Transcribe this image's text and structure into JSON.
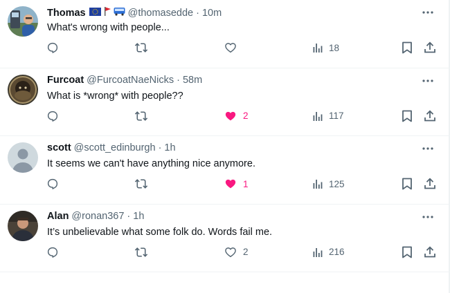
{
  "tweets": [
    {
      "name": "Thomas",
      "emojis": [
        "eu-flag",
        "red-flag",
        "bus"
      ],
      "handle": "@thomasedde",
      "separator": "·",
      "time": "10m",
      "text": "What's wrong with people...",
      "likes": "",
      "liked": false,
      "views": "18"
    },
    {
      "name": "Furcoat",
      "emojis": [],
      "handle": "@FurcoatNaeNicks",
      "separator": "·",
      "time": "58m",
      "text": "What is *wrong* with people??",
      "likes": "2",
      "liked": true,
      "views": "117"
    },
    {
      "name": "scott",
      "emojis": [],
      "handle": "@scott_edinburgh",
      "separator": "·",
      "time": "1h",
      "text": "It seems we can't have anything nice anymore.",
      "likes": "1",
      "liked": true,
      "views": "125"
    },
    {
      "name": "Alan",
      "emojis": [],
      "handle": "@ronan367",
      "separator": "·",
      "time": "1h",
      "text": "It’s unbelievable what some folk do. Words fail me.",
      "likes": "2",
      "liked": false,
      "views": "216"
    }
  ],
  "colors": {
    "text": "#0f1419",
    "secondary": "#536471",
    "like_pink": "#f91880",
    "border": "#eff3f4"
  },
  "icons": [
    "reply-icon",
    "retweet-icon",
    "like-icon",
    "views-icon",
    "bookmark-icon",
    "share-icon",
    "more-icon"
  ]
}
